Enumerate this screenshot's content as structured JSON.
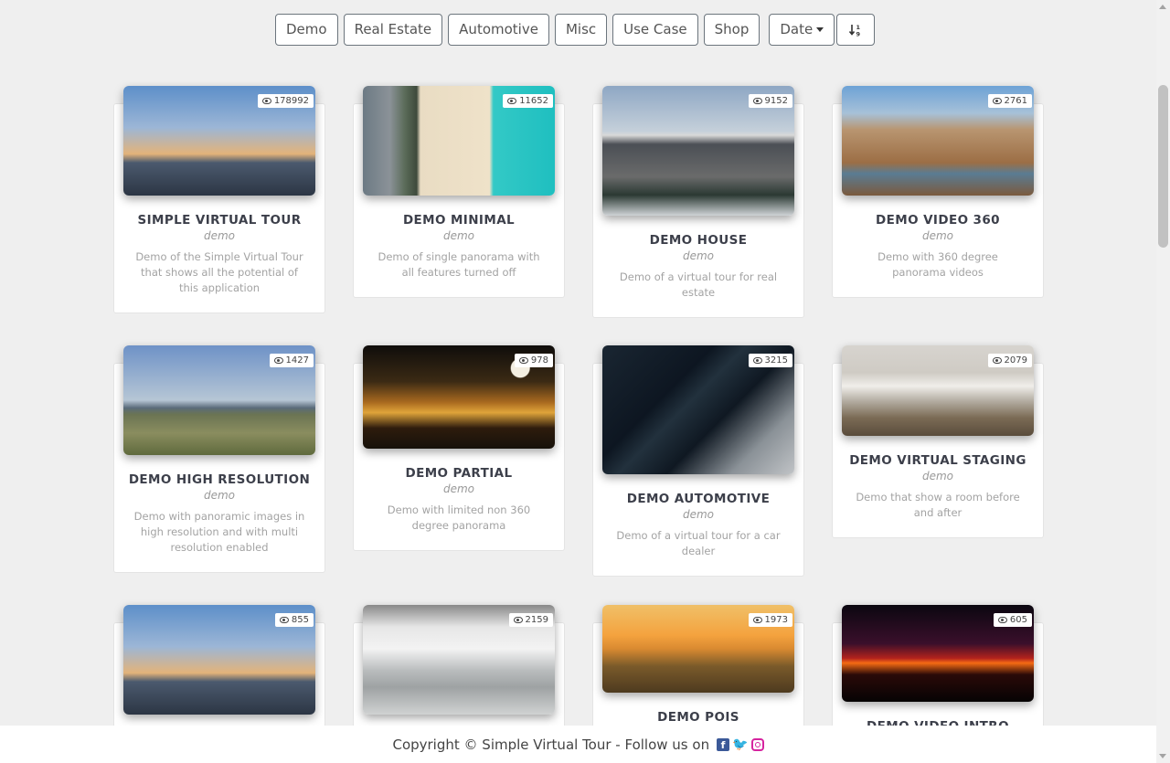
{
  "filters": [
    {
      "label": "Demo",
      "name": "filter-demo-button"
    },
    {
      "label": "Real Estate",
      "name": "filter-real-estate-button"
    },
    {
      "label": "Automotive",
      "name": "filter-automotive-button"
    },
    {
      "label": "Misc",
      "name": "filter-misc-button"
    },
    {
      "label": "Use Case",
      "name": "filter-use-case-button"
    },
    {
      "label": "Shop",
      "name": "filter-shop-button"
    }
  ],
  "sort": {
    "date_label": "Date",
    "order_icon": "sort-numeric-down-icon"
  },
  "tours": [
    {
      "title": "SIMPLE VIRTUAL TOUR",
      "category": "demo",
      "desc": "Demo of the Simple Virtual Tour that shows all the potential of this application",
      "views": "178992",
      "scene": "city"
    },
    {
      "title": "DEMO MINIMAL",
      "category": "demo",
      "desc": "Demo of single panorama with all features turned off",
      "views": "11652",
      "scene": "beach"
    },
    {
      "title": "DEMO HOUSE",
      "category": "demo",
      "desc": "Demo of a virtual tour for real estate",
      "views": "9152",
      "scene": "house"
    },
    {
      "title": "DEMO VIDEO 360",
      "category": "demo",
      "desc": "Demo with 360 degree panorama videos",
      "views": "2761",
      "scene": "river"
    },
    {
      "title": "DEMO HIGH RESOLUTION",
      "category": "demo",
      "desc": "Demo with panoramic images in high resolution and with multi resolution enabled",
      "views": "1427",
      "scene": "field"
    },
    {
      "title": "DEMO PARTIAL",
      "category": "demo",
      "desc": "Demo with limited non 360 degree panorama",
      "views": "978",
      "scene": "bridge"
    },
    {
      "title": "DEMO AUTOMOTIVE",
      "category": "demo",
      "desc": "Demo of a virtual tour for a car dealer",
      "views": "3215",
      "scene": "cars"
    },
    {
      "title": "DEMO VIRTUAL STAGING",
      "category": "demo",
      "desc": "Demo that show a room before and after",
      "views": "2079",
      "scene": "room"
    },
    {
      "title": "",
      "category": "",
      "desc": "",
      "views": "855",
      "scene": "city"
    },
    {
      "title": "",
      "category": "",
      "desc": "",
      "views": "2159",
      "scene": "store"
    },
    {
      "title": "DEMO POIS",
      "category": "",
      "desc": "",
      "views": "1973",
      "scene": "sunset"
    },
    {
      "title": "DEMO VIDEO INTRO",
      "category": "",
      "desc": "",
      "views": "605",
      "scene": "dusk"
    }
  ],
  "footer": {
    "text": "Copyright © Simple Virtual Tour - Follow us on",
    "social": [
      "facebook-icon",
      "twitter-icon",
      "instagram-icon"
    ]
  }
}
